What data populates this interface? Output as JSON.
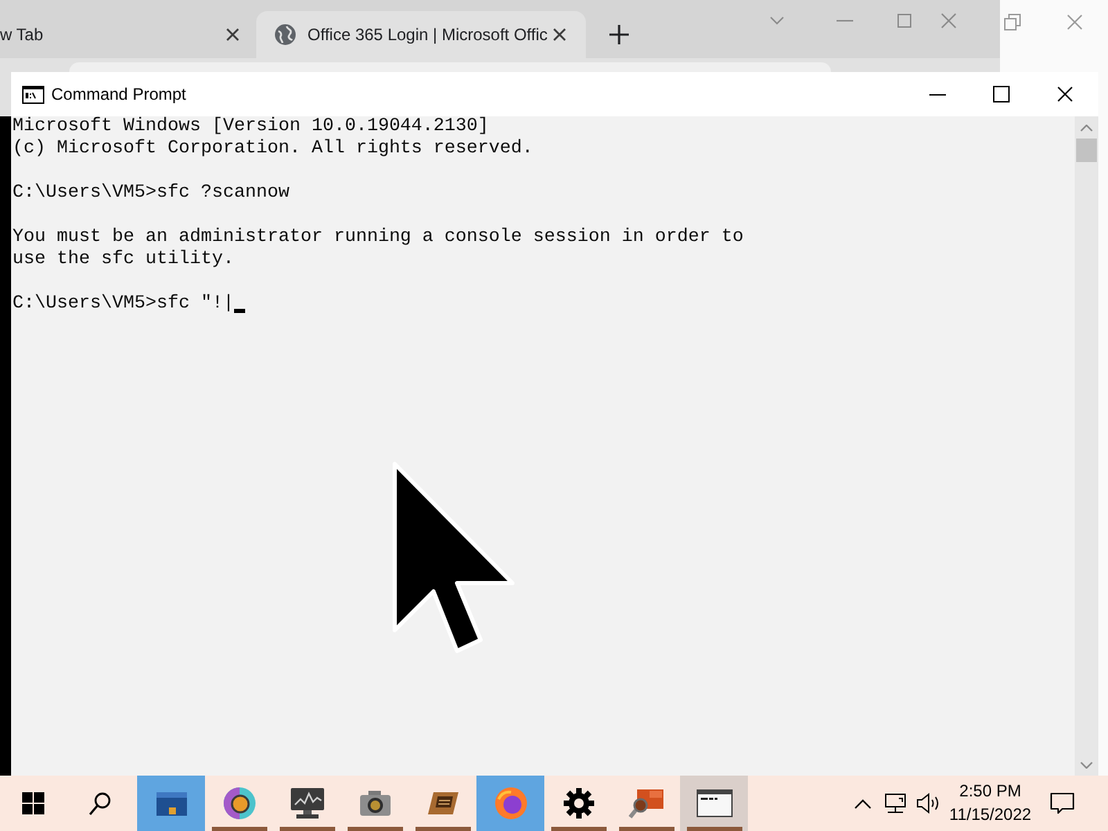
{
  "browser": {
    "tabs": [
      {
        "title": "w Tab",
        "selected": false
      },
      {
        "title": "Office 365 Login | Microsoft Offic",
        "selected": true,
        "favicon": true
      }
    ]
  },
  "console_window": {
    "title": "Command Prompt",
    "blocks": [
      [
        "Microsoft Windows [Version 10.0.19044.2130]",
        "(c) Microsoft Corporation. All rights reserved."
      ],
      [
        "C:\\Users\\VM5>sfc ?scannow"
      ],
      [
        "You must be an administrator running a console session in order to",
        "use the sfc utility."
      ],
      [
        "C:\\Users\\VM5>sfc \"!|"
      ]
    ]
  },
  "taskbar": {
    "apps": [
      {
        "kind": "folder",
        "highlighted": true,
        "selected": false,
        "running": false
      },
      {
        "kind": "orb",
        "highlighted": false,
        "selected": false,
        "running": true
      },
      {
        "kind": "monitor",
        "highlighted": false,
        "selected": false,
        "running": true
      },
      {
        "kind": "camera",
        "highlighted": false,
        "selected": false,
        "running": true
      },
      {
        "kind": "card",
        "highlighted": false,
        "selected": false,
        "running": true
      },
      {
        "kind": "flame",
        "highlighted": true,
        "selected": false,
        "running": false
      },
      {
        "kind": "gear",
        "highlighted": false,
        "selected": false,
        "running": true
      },
      {
        "kind": "magnifier",
        "highlighted": false,
        "selected": false,
        "running": true
      },
      {
        "kind": "terminal",
        "highlighted": false,
        "selected": true,
        "running": true
      }
    ],
    "clock": {
      "time": "2:50 PM",
      "date": "11/15/2022"
    }
  }
}
